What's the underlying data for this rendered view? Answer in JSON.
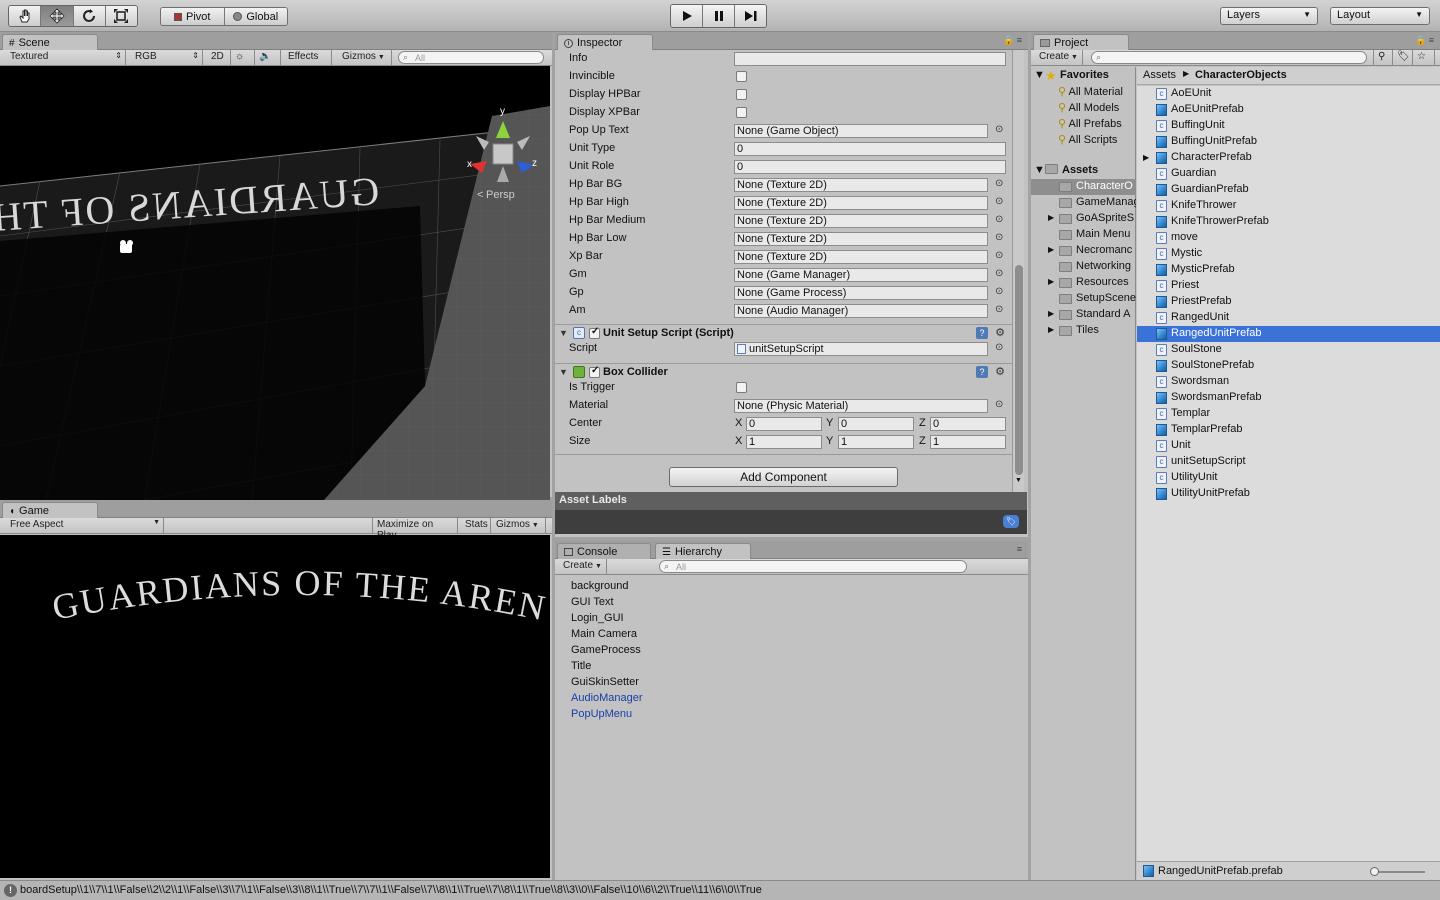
{
  "toolbar": {
    "pivot_label": "Pivot",
    "global_label": "Global",
    "layers_label": "Layers",
    "layout_label": "Layout"
  },
  "scene": {
    "tab_label": "Scene",
    "shading_mode": "Textured",
    "render_mode": "RGB",
    "mode_2d": "2D",
    "effects_label": "Effects",
    "gizmos_label": "Gizmos",
    "search_placeholder": "All",
    "persp_label": "Persp",
    "axis_x": "x",
    "axis_y": "y",
    "axis_z": "z",
    "title_text": "GUARDIANS OF THE ARENA"
  },
  "game": {
    "tab_label": "Game",
    "aspect_label": "Free Aspect",
    "maximize_label": "Maximize on Play",
    "stats_label": "Stats",
    "gizmos_label": "Gizmos",
    "title_text": "GUARDIANS OF THE ARENA"
  },
  "inspector": {
    "tab_label": "Inspector",
    "rows": [
      {
        "label": "Info",
        "value": "",
        "kind": "text"
      },
      {
        "label": "Invincible",
        "kind": "check"
      },
      {
        "label": "Display HPBar",
        "kind": "check"
      },
      {
        "label": "Display XPBar",
        "kind": "check"
      },
      {
        "label": "Pop Up Text",
        "value": "None (Game Object)",
        "kind": "object"
      },
      {
        "label": "Unit Type",
        "value": "0",
        "kind": "text"
      },
      {
        "label": "Unit Role",
        "value": "0",
        "kind": "text"
      },
      {
        "label": "Hp Bar BG",
        "value": "None (Texture 2D)",
        "kind": "object"
      },
      {
        "label": "Hp Bar High",
        "value": "None (Texture 2D)",
        "kind": "object"
      },
      {
        "label": "Hp Bar Medium",
        "value": "None (Texture 2D)",
        "kind": "object"
      },
      {
        "label": "Hp Bar Low",
        "value": "None (Texture 2D)",
        "kind": "object"
      },
      {
        "label": "Xp Bar",
        "value": "None (Texture 2D)",
        "kind": "object"
      },
      {
        "label": "Gm",
        "value": "None (Game Manager)",
        "kind": "object"
      },
      {
        "label": "Gp",
        "value": "None (Game Process)",
        "kind": "object"
      },
      {
        "label": "Am",
        "value": "None (Audio Manager)",
        "kind": "object"
      }
    ],
    "unit_setup": {
      "title": "Unit Setup Script (Script)",
      "script_label": "Script",
      "script_value": "unitSetupScript"
    },
    "box_collider": {
      "title": "Box Collider",
      "is_trigger_label": "Is Trigger",
      "material_label": "Material",
      "material_value": "None (Physic Material)",
      "center_label": "Center",
      "size_label": "Size",
      "center": {
        "x": "0",
        "y": "0",
        "z": "0"
      },
      "size": {
        "x": "1",
        "y": "1",
        "z": "1"
      },
      "axis_x": "X",
      "axis_y": "Y",
      "axis_z": "Z"
    },
    "add_component_label": "Add Component",
    "asset_labels_title": "Asset Labels"
  },
  "console_tab_label": "Console",
  "hierarchy": {
    "tab_label": "Hierarchy",
    "create_label": "Create",
    "search_placeholder": "All",
    "items": [
      {
        "label": "background",
        "prefab": false
      },
      {
        "label": "GUI Text",
        "prefab": false
      },
      {
        "label": "Login_GUI",
        "prefab": false
      },
      {
        "label": "Main Camera",
        "prefab": false
      },
      {
        "label": "GameProcess",
        "prefab": false
      },
      {
        "label": "Title",
        "prefab": false
      },
      {
        "label": "GuiSkinSetter",
        "prefab": false
      },
      {
        "label": "AudioManager",
        "prefab": true
      },
      {
        "label": "PopUpMenu",
        "prefab": true
      }
    ]
  },
  "project": {
    "tab_label": "Project",
    "create_label": "Create",
    "favorites_label": "Favorites",
    "favorites": [
      "All Material",
      "All Models",
      "All Prefabs",
      "All Scripts"
    ],
    "assets_label": "Assets",
    "folders": [
      {
        "label": "CharacterO",
        "expandable": false,
        "selected": true
      },
      {
        "label": "GameManag",
        "expandable": false,
        "selected": false
      },
      {
        "label": "GoASpriteS",
        "expandable": true,
        "selected": false
      },
      {
        "label": "Main Menu",
        "expandable": false,
        "selected": false
      },
      {
        "label": "Necromanc",
        "expandable": true,
        "selected": false
      },
      {
        "label": "Networking",
        "expandable": false,
        "selected": false
      },
      {
        "label": "Resources",
        "expandable": true,
        "selected": false
      },
      {
        "label": "SetupScene",
        "expandable": false,
        "selected": false
      },
      {
        "label": "Standard A",
        "expandable": true,
        "selected": false
      },
      {
        "label": "Tiles",
        "expandable": true,
        "selected": false
      }
    ],
    "breadcrumb_root": "Assets",
    "breadcrumb_current": "CharacterObjects",
    "items": [
      {
        "label": "AoEUnit",
        "type": "script"
      },
      {
        "label": "AoEUnitPrefab",
        "type": "prefab"
      },
      {
        "label": "BuffingUnit",
        "type": "script"
      },
      {
        "label": "BuffingUnitPrefab",
        "type": "prefab"
      },
      {
        "label": "CharacterPrefab",
        "type": "prefab",
        "expandable": true
      },
      {
        "label": "Guardian",
        "type": "script"
      },
      {
        "label": "GuardianPrefab",
        "type": "prefab"
      },
      {
        "label": "KnifeThrower",
        "type": "script"
      },
      {
        "label": "KnifeThrowerPrefab",
        "type": "prefab"
      },
      {
        "label": "move",
        "type": "script"
      },
      {
        "label": "Mystic",
        "type": "script"
      },
      {
        "label": "MysticPrefab",
        "type": "prefab"
      },
      {
        "label": "Priest",
        "type": "script"
      },
      {
        "label": "PriestPrefab",
        "type": "prefab"
      },
      {
        "label": "RangedUnit",
        "type": "script"
      },
      {
        "label": "RangedUnitPrefab",
        "type": "prefab",
        "selected": true
      },
      {
        "label": "SoulStone",
        "type": "script"
      },
      {
        "label": "SoulStonePrefab",
        "type": "prefab"
      },
      {
        "label": "Swordsman",
        "type": "script"
      },
      {
        "label": "SwordsmanPrefab",
        "type": "prefab"
      },
      {
        "label": "Templar",
        "type": "script"
      },
      {
        "label": "TemplarPrefab",
        "type": "prefab"
      },
      {
        "label": "Unit",
        "type": "script"
      },
      {
        "label": "unitSetupScript",
        "type": "script"
      },
      {
        "label": "UtilityUnit",
        "type": "script"
      },
      {
        "label": "UtilityUnitPrefab",
        "type": "prefab"
      }
    ],
    "footer_file": "RangedUnitPrefab.prefab"
  },
  "status": {
    "message": "boardSetup\\\\1\\\\7\\\\1\\\\False\\\\2\\\\2\\\\1\\\\False\\\\3\\\\7\\\\1\\\\False\\\\3\\\\8\\\\1\\\\True\\\\7\\\\7\\\\1\\\\False\\\\7\\\\8\\\\1\\\\True\\\\7\\\\8\\\\1\\\\True\\\\8\\\\3\\\\0\\\\False\\\\10\\\\6\\\\2\\\\True\\\\11\\\\6\\\\0\\\\True"
  },
  "colors": {
    "selection": "#3a72d8",
    "prefab_text": "#1a3fa8",
    "panel_bg": "#c2c2c2"
  }
}
